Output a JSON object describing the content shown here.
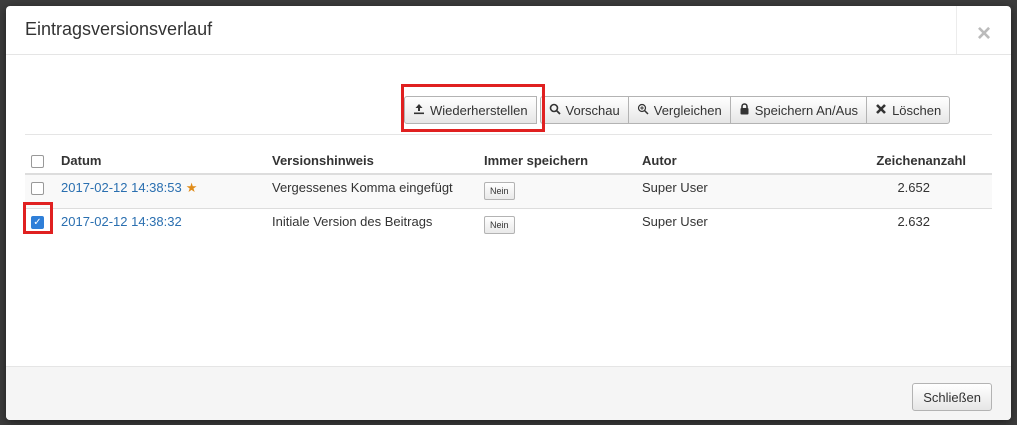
{
  "modal": {
    "title": "Eintragsversionsverlauf",
    "close_glyph": "×"
  },
  "toolbar": {
    "buttons": [
      {
        "label": "Wiederherstellen",
        "icon": "upload-icon",
        "glyph": "⤒"
      },
      {
        "label": "Vorschau",
        "icon": "search-icon",
        "glyph": "🔍"
      },
      {
        "label": "Vergleichen",
        "icon": "zoom-in-icon",
        "glyph": "⊕"
      },
      {
        "label": "Speichern An/Aus",
        "icon": "lock-icon",
        "glyph": "🔒"
      },
      {
        "label": "Löschen",
        "icon": "delete-x-icon",
        "glyph": "✖"
      }
    ]
  },
  "table": {
    "headers": {
      "date": "Datum",
      "note": "Versionshinweis",
      "keep": "Immer speichern",
      "author": "Autor",
      "chars": "Zeichenanzahl"
    },
    "rows": [
      {
        "date": "2017-02-12 14:38:53",
        "starred": true,
        "note": "Vergessenes Komma eingefügt",
        "keep": "Nein",
        "author": "Super User",
        "chars": "2.652",
        "checked": false
      },
      {
        "date": "2017-02-12 14:38:32",
        "starred": false,
        "note": "Initiale Version des Beitrags",
        "keep": "Nein",
        "author": "Super User",
        "chars": "2.632",
        "checked": true
      }
    ]
  },
  "footer": {
    "close_label": "Schließen"
  },
  "colors": {
    "highlight": "#e02020",
    "link": "#2a6fb0",
    "star": "#e08c1a",
    "checkbox_checked": "#2f7fd8"
  }
}
